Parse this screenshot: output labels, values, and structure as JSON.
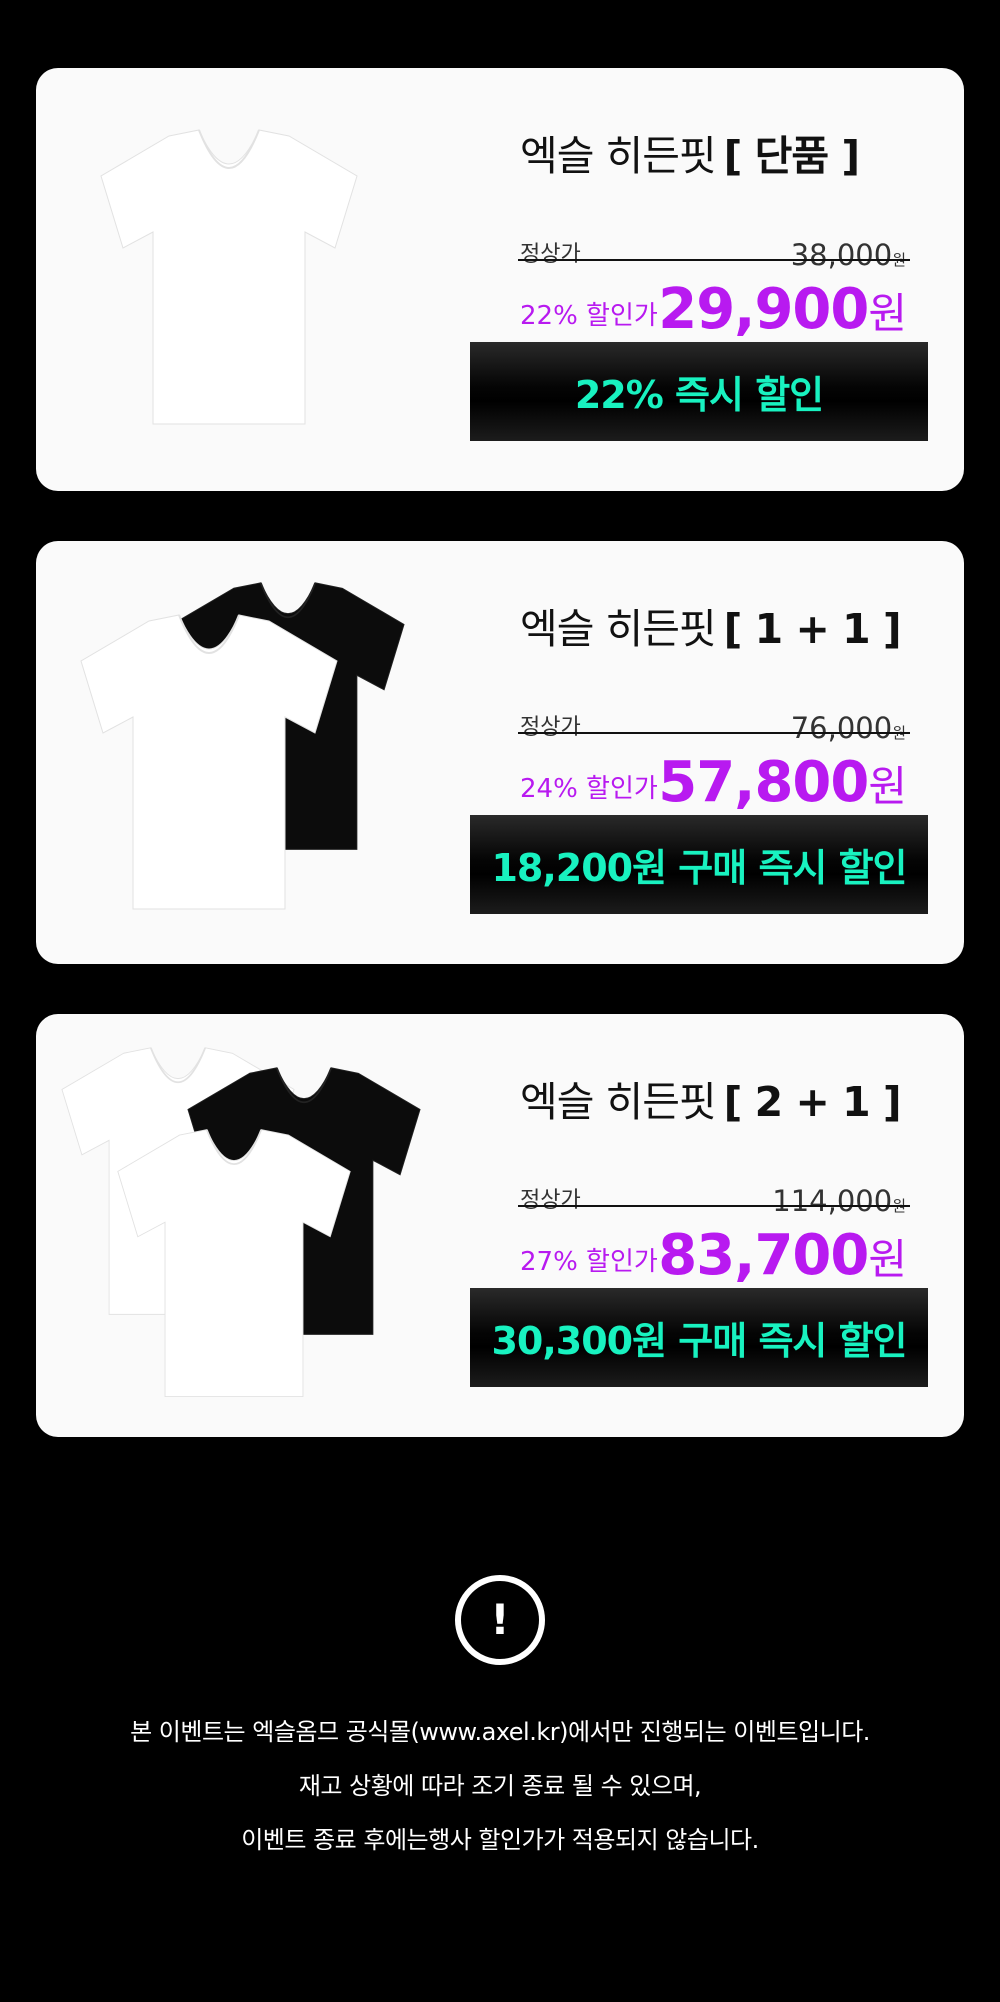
{
  "products": [
    {
      "name": "엑슬 히든핏",
      "option": "[ 단품 ]",
      "regular_label": "정상가",
      "regular_price": "38,000",
      "regular_unit": "원",
      "discount_label": "22% 할인가",
      "sale_price": "29,900",
      "sale_unit": "원",
      "banner": "22% 즉시 할인"
    },
    {
      "name": "엑슬 히든핏",
      "option": "[ 1 + 1 ]",
      "regular_label": "정상가",
      "regular_price": "76,000",
      "regular_unit": "원",
      "discount_label": "24% 할인가",
      "sale_price": "57,800",
      "sale_unit": "원",
      "banner": "18,200원 구매 즉시 할인"
    },
    {
      "name": "엑슬 히든핏",
      "option": "[ 2 + 1 ]",
      "regular_label": "정상가",
      "regular_price": "114,000",
      "regular_unit": "원",
      "discount_label": "27% 할인가",
      "sale_price": "83,700",
      "sale_unit": "원",
      "banner": "30,300원 구매 즉시 할인"
    }
  ],
  "notice": {
    "icon": "!",
    "lines": [
      "본 이벤트는 엑슬옴므 공식몰(www.axel.kr)에서만 진행되는 이벤트입니다.",
      "재고 상황에 따라 조기 종료 될 수 있으며,",
      "이벤트 종료 후에는행사 할인가가 적용되지 않습니다."
    ]
  },
  "colors": {
    "background": "#000000",
    "card": "#fafafa",
    "accent_purple": "#b81af0",
    "accent_mint": "#18f2c0"
  }
}
